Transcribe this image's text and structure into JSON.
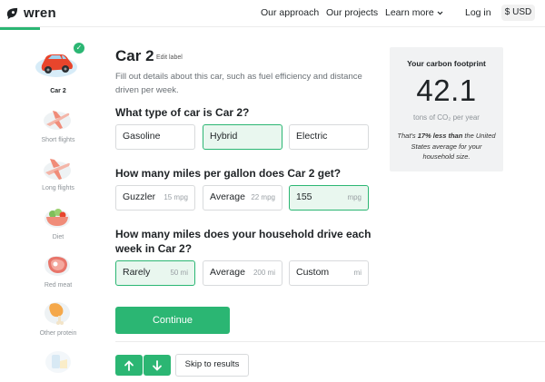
{
  "brand": {
    "name": "wren",
    "accent": "#2bb673"
  },
  "nav": {
    "approach": "Our approach",
    "projects": "Our projects",
    "learn_more": "Learn more",
    "login": "Log in",
    "currency": "$ USD"
  },
  "sidebar": {
    "items": [
      {
        "label": "Car 2",
        "icon": "car-icon",
        "active": true,
        "completed": true
      },
      {
        "label": "Short flights",
        "icon": "airplane-icon"
      },
      {
        "label": "Long flights",
        "icon": "airplane-icon"
      },
      {
        "label": "Diet",
        "icon": "salad-bowl-icon"
      },
      {
        "label": "Red meat",
        "icon": "steak-icon"
      },
      {
        "label": "Other protein",
        "icon": "chicken-leg-icon"
      },
      {
        "label": "",
        "icon": "dairy-icon"
      }
    ]
  },
  "main": {
    "title": "Car 2",
    "edit_label": "Edit label",
    "description": "Fill out details about this car, such as fuel efficiency and distance driven per week.",
    "q1": {
      "text": "What type of car is Car 2?",
      "options": [
        {
          "label": "Gasoline",
          "selected": false
        },
        {
          "label": "Hybrid",
          "selected": true
        },
        {
          "label": "Electric",
          "selected": false
        }
      ]
    },
    "q2": {
      "text": "How many miles per gallon does Car 2 get?",
      "options": [
        {
          "label": "Guzzler",
          "unit": "15 mpg",
          "selected": false
        },
        {
          "label": "Average",
          "unit": "22 mpg",
          "selected": false
        },
        {
          "label": "155",
          "unit": "mpg",
          "selected": true
        }
      ]
    },
    "q3": {
      "text_line1": "How many miles does your household drive each",
      "text_line2": "week in Car 2?",
      "options": [
        {
          "label": "Rarely",
          "unit": "50 mi",
          "selected": true
        },
        {
          "label": "Average",
          "unit": "200 mi",
          "selected": false
        },
        {
          "label": "Custom",
          "unit": "mi",
          "selected": false
        }
      ]
    },
    "continue_label": "Continue",
    "skip_label": "Skip to results"
  },
  "footprint": {
    "title": "Your carbon footprint",
    "value": "42.1",
    "unit": "tons of CO₂ per year",
    "note_prefix": "That's ",
    "note_bold": "17% less than",
    "note_suffix": " the United States average for your household size."
  }
}
